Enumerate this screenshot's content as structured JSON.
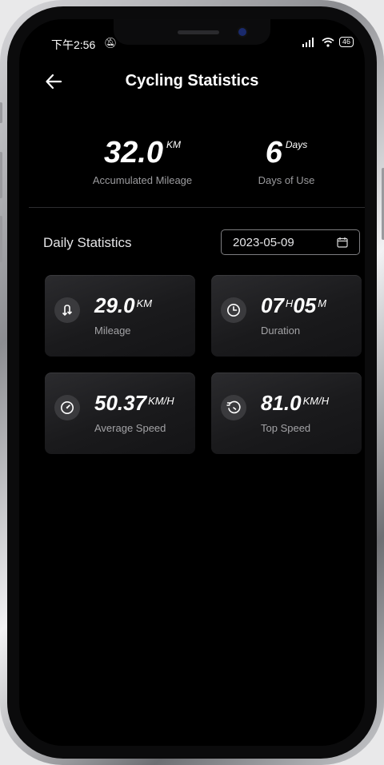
{
  "status_bar": {
    "time": "下午2:56",
    "battery": "46"
  },
  "header": {
    "title": "Cycling Statistics"
  },
  "summary": {
    "mileage": {
      "value": "32.0",
      "unit": "KM",
      "label": "Accumulated Mileage"
    },
    "days": {
      "value": "6",
      "unit": "Days",
      "label": "Days of Use"
    }
  },
  "daily": {
    "title": "Daily Statistics",
    "date": "2023-05-09",
    "cards": {
      "mileage": {
        "value": "29.0",
        "unit": "KM",
        "label": "Mileage"
      },
      "duration": {
        "hours": "07",
        "hours_unit": "H",
        "minutes": "05",
        "minutes_unit": "M",
        "label": "Duration"
      },
      "avg_speed": {
        "value": "50.37",
        "unit": "KM/H",
        "label": "Average Speed"
      },
      "top_speed": {
        "value": "81.0",
        "unit": "KM/H",
        "label": "Top Speed"
      }
    }
  },
  "icons": {
    "back": "back-arrow-icon",
    "calendar": "calendar-icon",
    "mileage": "route-arrows-icon",
    "duration": "clock-icon",
    "avg_speed": "gauge-icon",
    "top_speed": "speed-timer-icon"
  }
}
